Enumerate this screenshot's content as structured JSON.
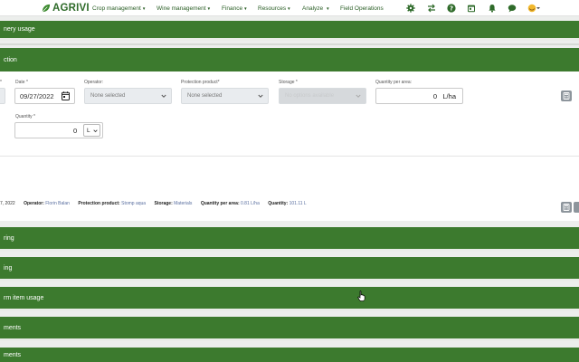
{
  "header": {
    "logo": "AGRIVI",
    "nav": [
      {
        "label": "Crop management",
        "has_caret": true
      },
      {
        "label": "Wine management",
        "has_caret": true
      },
      {
        "label": "Finance",
        "has_caret": true
      },
      {
        "label": "Resources",
        "has_caret": true
      },
      {
        "label": "Analyze",
        "has_caret": true
      },
      {
        "label": "Field Operations",
        "has_caret": false
      }
    ],
    "icons": [
      "gear-icon",
      "transfer-icon",
      "help-icon",
      "calendar-icon",
      "bell-icon",
      "chat-icon",
      "user-avatar-icon"
    ]
  },
  "sections": {
    "machinery": "nery usage",
    "protection": "ction",
    "s3": "ring",
    "s4": "ing",
    "s5": "rm item usage",
    "s6": "ments",
    "s7": "ments"
  },
  "form": {
    "date_label": "Date",
    "date_value": "09/27/2022",
    "operator_label": "Operator:",
    "operator_value": "None selected",
    "protection_label": "Protection product",
    "protection_value": "None selected",
    "storage_label": "Storage",
    "storage_value": "No options available",
    "qpa_label": "Quantity per area:",
    "qpa_value": "0",
    "qpa_unit": "L/ha",
    "quantity_label": "Quantity",
    "quantity_value": "0",
    "quantity_unit": "L",
    "required_marker": "*"
  },
  "summary": {
    "date": "7, 2022",
    "operator_label": "Operator:",
    "operator_value": "Florin Balan",
    "product_label": "Protection product:",
    "product_value": "Stomp aqua",
    "storage_label": "Storage:",
    "storage_value": "Materials",
    "qpa_label": "Quantity per area:",
    "qpa_value": "0.81 L/ha",
    "quantity_label": "Quantity:",
    "quantity_value": "101.11 L"
  },
  "colors": {
    "brand_green": "#3c7a2e",
    "nav_text": "#2a5e25",
    "logo_green": "#2f6b2a"
  }
}
